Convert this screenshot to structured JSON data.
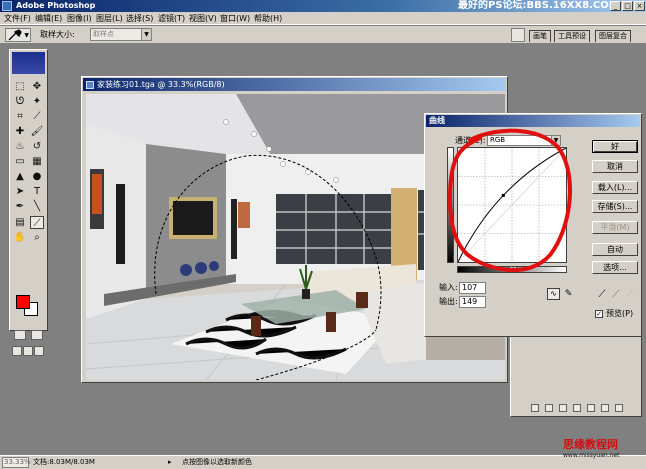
{
  "app": {
    "title": "Adobe Photoshop",
    "watermark": "最好的PS论坛:BBS.16XX8.COM",
    "window_buttons": [
      "_",
      "□",
      "×"
    ]
  },
  "menu": [
    "文件(F)",
    "编辑(E)",
    "图像(I)",
    "图层(L)",
    "选择(S)",
    "滤镜(T)",
    "视图(V)",
    "窗口(W)",
    "帮助(H)"
  ],
  "options": {
    "sample_size_label": "取样大小:",
    "sample_size_value": "取样点",
    "palette_tabs": [
      "画笔",
      "工具预设",
      "图层复合"
    ]
  },
  "document": {
    "title": "家装练习01.tga @ 33.3%(RGB/8)"
  },
  "curves": {
    "title": "曲线",
    "channel_label": "通道(C):",
    "channel_value": "RGB",
    "input_label": "输入:",
    "input_value": "107",
    "output_label": "输出:",
    "output_value": "149",
    "buttons": {
      "ok": "好",
      "cancel": "取消",
      "load": "载入(L)...",
      "save": "存储(S)...",
      "smooth": "平滑(M)",
      "auto": "自动",
      "options": "选项..."
    },
    "preview_label": "预览(P)",
    "preview_checked": true,
    "curve_points": [
      [
        0,
        0
      ],
      [
        107,
        149
      ],
      [
        255,
        255
      ]
    ]
  },
  "status": {
    "zoom": "33.33%",
    "doc_size": "文档:8.03M/8.03M",
    "message": "点按图像以选取新颜色"
  },
  "site_watermark": {
    "brand": "思缘教程网",
    "url": "www.missyuan.net"
  }
}
